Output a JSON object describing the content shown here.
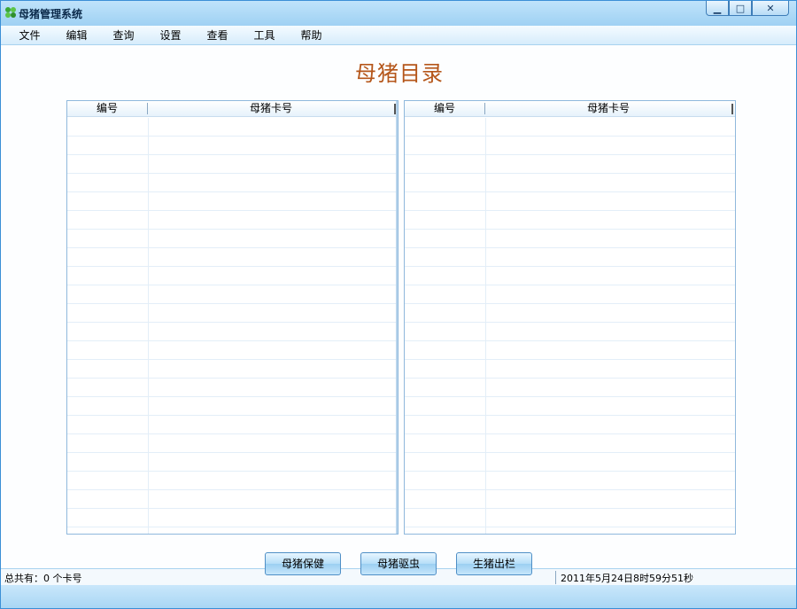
{
  "window": {
    "title": "母猪管理系统",
    "icon": "app-leaf-icon",
    "controls": [
      "minimize-icon",
      "maximize-icon",
      "close-icon"
    ]
  },
  "menu": {
    "items": [
      "文件",
      "编辑",
      "查询",
      "设置",
      "查看",
      "工具",
      "帮助"
    ]
  },
  "page": {
    "title": "母猪目录"
  },
  "tables": {
    "left": {
      "col1": "编号",
      "col2": "母猪卡号",
      "rows": []
    },
    "right": {
      "col1": "编号",
      "col2": "母猪卡号",
      "rows": []
    }
  },
  "buttons": {
    "health": "母猪保健",
    "deworm": "母猪驱虫",
    "shipout": "生猪出栏"
  },
  "status": {
    "total": "总共有：0 个卡号",
    "datetime": "2011年5月24日8时59分51秒"
  },
  "colors": {
    "title_color": "#b5561a",
    "accent": "#3b8fd6"
  }
}
